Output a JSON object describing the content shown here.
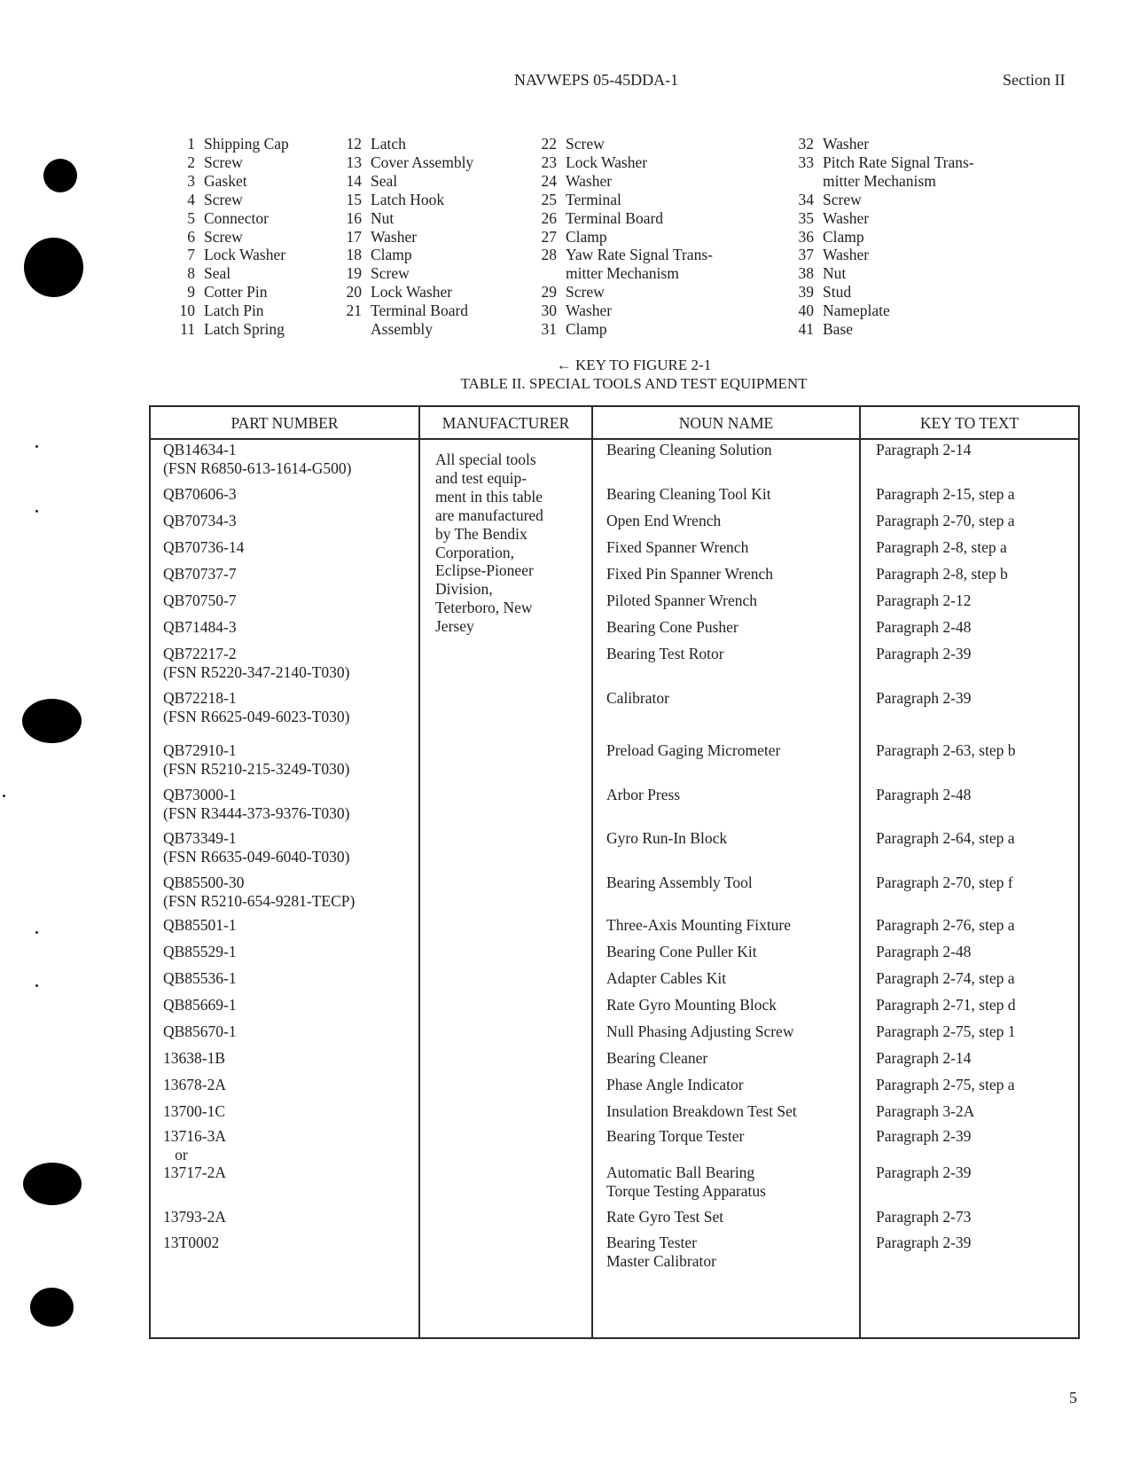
{
  "header": {
    "document_id": "NAVWEPS 05-45DDA-1",
    "section": "Section II"
  },
  "figure_key": {
    "columns": [
      [
        {
          "num": "1",
          "label": "Shipping Cap"
        },
        {
          "num": "2",
          "label": "Screw"
        },
        {
          "num": "3",
          "label": "Gasket"
        },
        {
          "num": "4",
          "label": "Screw"
        },
        {
          "num": "5",
          "label": "Connector"
        },
        {
          "num": "6",
          "label": "Screw"
        },
        {
          "num": "7",
          "label": "Lock Washer"
        },
        {
          "num": "8",
          "label": "Seal"
        },
        {
          "num": "9",
          "label": "Cotter Pin"
        },
        {
          "num": "10",
          "label": "Latch Pin"
        },
        {
          "num": "11",
          "label": "Latch Spring"
        }
      ],
      [
        {
          "num": "12",
          "label": "Latch"
        },
        {
          "num": "13",
          "label": "Cover Assembly"
        },
        {
          "num": "14",
          "label": "Seal"
        },
        {
          "num": "15",
          "label": "Latch Hook"
        },
        {
          "num": "16",
          "label": "Nut"
        },
        {
          "num": "17",
          "label": "Washer"
        },
        {
          "num": "18",
          "label": "Clamp"
        },
        {
          "num": "19",
          "label": "Screw"
        },
        {
          "num": "20",
          "label": "Lock Washer"
        },
        {
          "num": "21",
          "label": "Terminal Board"
        },
        {
          "num": "",
          "label": "Assembly"
        }
      ],
      [
        {
          "num": "22",
          "label": "Screw"
        },
        {
          "num": "23",
          "label": "Lock Washer"
        },
        {
          "num": "24",
          "label": "Washer"
        },
        {
          "num": "25",
          "label": "Terminal"
        },
        {
          "num": "26",
          "label": "Terminal Board"
        },
        {
          "num": "27",
          "label": "Clamp"
        },
        {
          "num": "28",
          "label": "Yaw Rate Signal Trans-"
        },
        {
          "num": "",
          "label": "mitter Mechanism"
        },
        {
          "num": "29",
          "label": "Screw"
        },
        {
          "num": "30",
          "label": "Washer"
        },
        {
          "num": "31",
          "label": "Clamp"
        }
      ],
      [
        {
          "num": "32",
          "label": "Washer"
        },
        {
          "num": "33",
          "label": "Pitch Rate Signal Trans-"
        },
        {
          "num": "",
          "label": "mitter Mechanism"
        },
        {
          "num": "34",
          "label": "Screw"
        },
        {
          "num": "35",
          "label": "Washer"
        },
        {
          "num": "36",
          "label": "Clamp"
        },
        {
          "num": "37",
          "label": "Washer"
        },
        {
          "num": "38",
          "label": "Nut"
        },
        {
          "num": "39",
          "label": "Stud"
        },
        {
          "num": "40",
          "label": "Nameplate"
        },
        {
          "num": "41",
          "label": "Base"
        }
      ]
    ],
    "caption": "← KEY TO FIGURE 2-1"
  },
  "table": {
    "title": "TABLE II.  SPECIAL TOOLS AND TEST EQUIPMENT",
    "headers": [
      "PART NUMBER",
      "MANUFACTURER",
      "NOUN NAME",
      "KEY TO TEXT"
    ],
    "manufacturer_note": [
      "All special tools",
      "and test equip-",
      "ment in this table",
      "are manufactured",
      "by The Bendix",
      "Corporation,",
      "Eclipse-Pioneer",
      "Division,",
      "Teterboro, New",
      "Jersey"
    ],
    "rows": [
      {
        "part": [
          "QB14634-1",
          "(FSN R6850-613-1614-G500)"
        ],
        "noun": [
          "Bearing Cleaning Solution"
        ],
        "key": "Paragraph 2-14"
      },
      {
        "part": [
          "QB70606-3"
        ],
        "noun": [
          "Bearing Cleaning Tool Kit"
        ],
        "key": "Paragraph 2-15, step a"
      },
      {
        "part": [
          "QB70734-3"
        ],
        "noun": [
          "Open End Wrench"
        ],
        "key": "Paragraph 2-70, step a"
      },
      {
        "part": [
          "QB70736-14"
        ],
        "noun": [
          "Fixed Spanner Wrench"
        ],
        "key": "Paragraph 2-8, step a"
      },
      {
        "part": [
          "QB70737-7"
        ],
        "noun": [
          "Fixed Pin Spanner Wrench"
        ],
        "key": "Paragraph 2-8, step b"
      },
      {
        "part": [
          "QB70750-7"
        ],
        "noun": [
          "Piloted Spanner Wrench"
        ],
        "key": "Paragraph 2-12"
      },
      {
        "part": [
          "QB71484-3"
        ],
        "noun": [
          "Bearing Cone Pusher"
        ],
        "key": "Paragraph 2-48"
      },
      {
        "part": [
          "QB72217-2",
          "(FSN R5220-347-2140-T030)"
        ],
        "noun": [
          "Bearing Test Rotor"
        ],
        "key": "Paragraph 2-39"
      },
      {
        "part": [
          "QB72218-1",
          "(FSN R6625-049-6023-T030)"
        ],
        "noun": [
          "Calibrator"
        ],
        "key": "Paragraph 2-39"
      },
      {
        "part": [
          "QB72910-1",
          "(FSN R5210-215-3249-T030)"
        ],
        "noun": [
          "Preload Gaging Micrometer"
        ],
        "key": "Paragraph 2-63, step b"
      },
      {
        "part": [
          "QB73000-1",
          "(FSN R3444-373-9376-T030)"
        ],
        "noun": [
          "Arbor Press"
        ],
        "key": "Paragraph 2-48"
      },
      {
        "part": [
          "QB73349-1",
          "(FSN R6635-049-6040-T030)"
        ],
        "noun": [
          "Gyro Run-In Block"
        ],
        "key": "Paragraph 2-64, step a"
      },
      {
        "part": [
          "QB85500-30",
          "(FSN R5210-654-9281-TECP)"
        ],
        "noun": [
          "Bearing Assembly Tool"
        ],
        "key": "Paragraph 2-70, step f"
      },
      {
        "part": [
          "QB85501-1"
        ],
        "noun": [
          "Three-Axis Mounting Fixture"
        ],
        "key": "Paragraph 2-76, step a"
      },
      {
        "part": [
          "QB85529-1"
        ],
        "noun": [
          "Bearing Cone Puller Kit"
        ],
        "key": "Paragraph 2-48"
      },
      {
        "part": [
          "QB85536-1"
        ],
        "noun": [
          "Adapter Cables Kit"
        ],
        "key": "Paragraph 2-74, step a"
      },
      {
        "part": [
          "QB85669-1"
        ],
        "noun": [
          "Rate Gyro Mounting Block"
        ],
        "key": "Paragraph 2-71, step d"
      },
      {
        "part": [
          "QB85670-1"
        ],
        "noun": [
          "Null Phasing Adjusting Screw"
        ],
        "key": "Paragraph 2-75, step 1"
      },
      {
        "part": [
          "13638-1B"
        ],
        "noun": [
          "Bearing Cleaner"
        ],
        "key": "Paragraph 2-14"
      },
      {
        "part": [
          "13678-2A"
        ],
        "noun": [
          "Phase Angle Indicator"
        ],
        "key": "Paragraph 2-75, step a"
      },
      {
        "part": [
          "13700-1C"
        ],
        "noun": [
          "Insulation Breakdown Test Set"
        ],
        "key": "Paragraph 3-2A"
      },
      {
        "part": [
          "13716-3A",
          "   or"
        ],
        "noun": [
          "Bearing Torque Tester"
        ],
        "key": "Paragraph 2-39"
      },
      {
        "part": [
          "13717-2A"
        ],
        "noun": [
          "Automatic Ball Bearing",
          "Torque Testing Apparatus"
        ],
        "key": "Paragraph 2-39"
      },
      {
        "part": [
          "13793-2A"
        ],
        "noun": [
          "Rate Gyro Test Set"
        ],
        "key": "Paragraph 2-73"
      },
      {
        "part": [
          "13T0002"
        ],
        "noun": [
          "Bearing Tester",
          "Master Calibrator"
        ],
        "key": "Paragraph 2-39"
      }
    ]
  },
  "footer": {
    "page_number": "5"
  }
}
